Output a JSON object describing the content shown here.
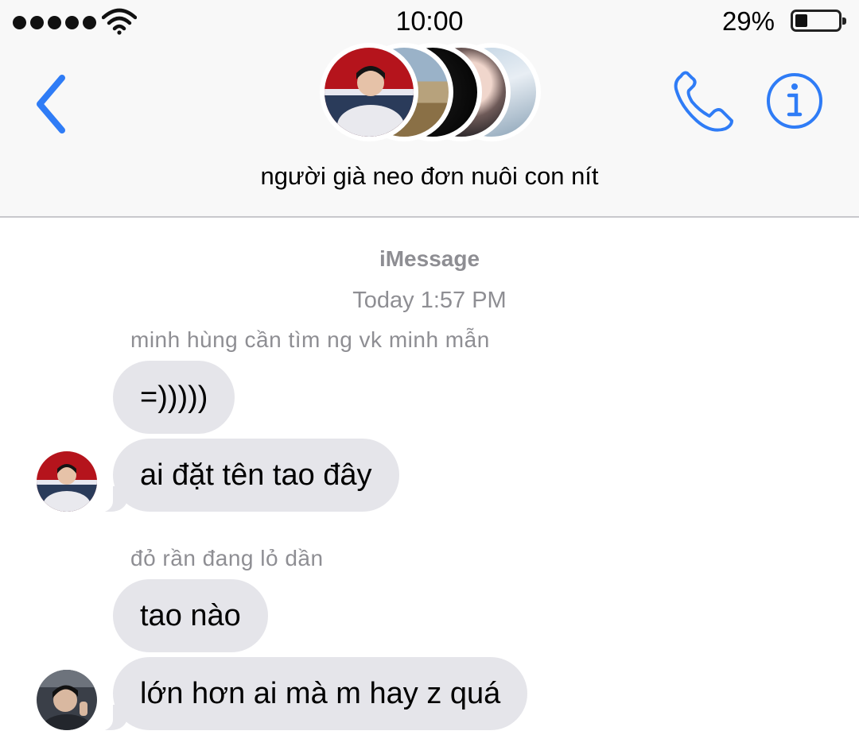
{
  "status_bar": {
    "time": "10:00",
    "battery_percent": "29%",
    "battery_level": 0.29,
    "signal_bars": 5,
    "wifi_icon": "wifi-icon"
  },
  "header": {
    "group_name": "người già neo đơn nuôi con nít",
    "back_icon": "chevron-left-icon",
    "call_icon": "phone-icon",
    "info_icon": "info-icon",
    "accent_color": "#2f7cf6"
  },
  "thread": {
    "service": "iMessage",
    "timestamp": "Today 1:57 PM",
    "groups": [
      {
        "sender": "minh hùng cần tìm ng vk minh mẫn",
        "messages": [
          "=)))))",
          "ai đặt tên tao đây"
        ]
      },
      {
        "sender": "đỏ rần đang lỏ dần",
        "messages": [
          "tao nào",
          "lớn hơn ai mà m hay z quá"
        ]
      }
    ]
  },
  "colors": {
    "incoming_bubble": "#e5e5ea",
    "meta_text": "#8e8e93",
    "header_bg": "#f8f8f8"
  }
}
